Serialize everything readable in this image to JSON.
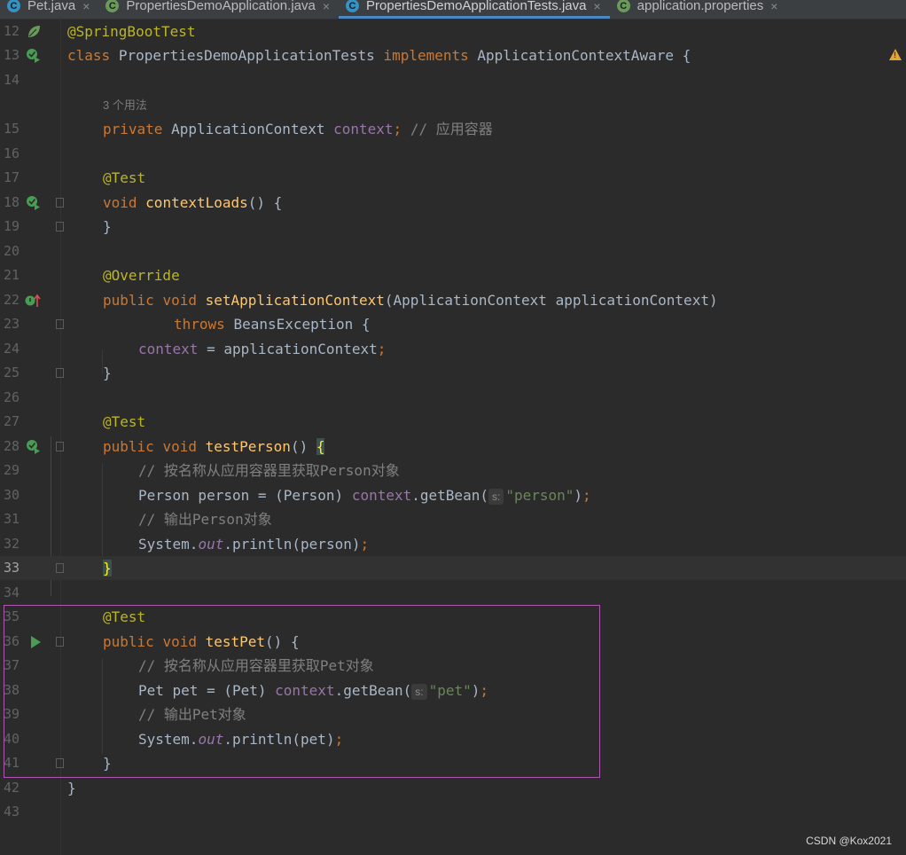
{
  "tabs": [
    {
      "label": "Pet.java",
      "icon": "class-icon",
      "active": false
    },
    {
      "label": "PropertiesDemoApplication.java",
      "icon": "spring-class-icon",
      "active": false
    },
    {
      "label": "PropertiesDemoApplicationTests.java",
      "icon": "class-icon",
      "active": true
    },
    {
      "label": "application.properties",
      "icon": "spring-properties-icon",
      "active": false
    }
  ],
  "close_glyph": "×",
  "tab_icon_letter": "C",
  "code": {
    "line_numbers": [
      "12",
      "13",
      "14",
      "15",
      "16",
      "17",
      "18",
      "19",
      "20",
      "21",
      "22",
      "23",
      "24",
      "25",
      "26",
      "27",
      "28",
      "29",
      "30",
      "31",
      "32",
      "33",
      "34",
      "35",
      "36",
      "37",
      "38",
      "39",
      "40",
      "41",
      "42",
      "43"
    ],
    "usage_hint": "3 个用法",
    "param_hint": "s:",
    "annotation_springboottest": "@SpringBootTest",
    "kw_class": "class",
    "class_name": "PropertiesDemoApplicationTests",
    "kw_implements": "implements",
    "interface_name": "ApplicationContextAware",
    "brace_open": "{",
    "brace_close": "}",
    "kw_private": "private",
    "type_appcontext": "ApplicationContext",
    "field_context": "context",
    "semicolon": ";",
    "comment_container": "// 应用容器",
    "annotation_test": "@Test",
    "kw_void": "void",
    "method_contextloads": "contextLoads",
    "parens_open_brace": "() {",
    "annotation_override": "@Override",
    "kw_public": "public",
    "method_setappcontext": "setApplicationContext",
    "param_list": "(ApplicationContext applicationContext)",
    "kw_throws": "throws",
    "exception_tail": "BeansException {",
    "assign_tail": " = applicationContext",
    "method_testperson": "testPerson",
    "parens": "() ",
    "comment_get_person": "// 按名称从应用容器里获取Person对象",
    "person_decl": "Person person = (Person) ",
    "getbean_call": ".getBean(",
    "string_person": "\"person\"",
    "close_paren": ")",
    "comment_output_person": "// 输出Person对象",
    "sysout_prefix": "System.",
    "sysout_out": "out",
    "println_person": ".println(person)",
    "method_testpet": "testPet",
    "comment_get_pet": "// 按名称从应用容器里获取Pet对象",
    "pet_decl": "Pet pet = (Pet) ",
    "string_pet": "\"pet\"",
    "comment_output_pet": "// 输出Pet对象",
    "println_pet": ".println(pet)"
  },
  "watermark": "CSDN @Kox2021",
  "colors": {
    "background": "#2b2b2b",
    "keyword": "#cc7832",
    "annotation": "#bbb529",
    "method": "#ffc66d",
    "field": "#9876aa",
    "string": "#6a8759",
    "comment": "#808080",
    "highlight_box": "#b055b0",
    "active_tab_underline": "#4a88c7"
  }
}
